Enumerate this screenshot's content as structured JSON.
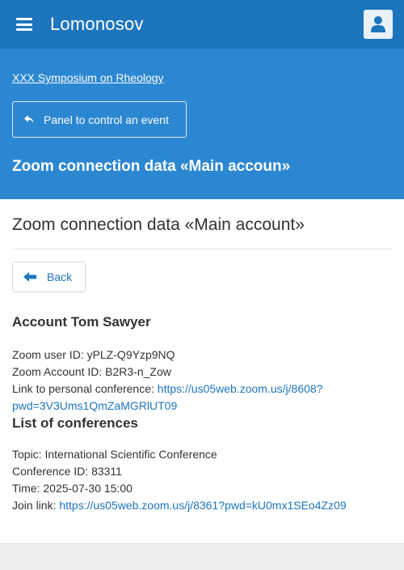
{
  "app": {
    "title": "Lomonosov"
  },
  "icons": {
    "menu": "hamburger-icon",
    "user": "user-icon",
    "reply": "reply-arrow-icon",
    "back": "left-arrow-icon"
  },
  "colors": {
    "topbar": "#1d75bd",
    "hero": "#2b87d2",
    "link": "#1d75bd"
  },
  "hero": {
    "breadcrumb": "XXX Symposium on Rheology",
    "panel_button": "Panel to control an event",
    "title": "Zoom connection data «Main accoun»"
  },
  "main": {
    "title": "Zoom connection data «Main account»",
    "back_label": "Back",
    "account": {
      "heading": "Account Tom Sawyer",
      "user_id_label": "Zoom user ID: ",
      "user_id": "yPLZ-Q9Yzp9NQ",
      "account_id_label": "Zoom Account ID: ",
      "account_id": "B2R3-n_Zow",
      "link_label": "Link to personal conference: ",
      "link_line1": "https://us05web.zoom.us/j/8608?",
      "link_line2": "pwd=3V3Ums1QmZaMGRlUT09"
    },
    "conferences": {
      "heading": "List of conferences",
      "items": [
        {
          "topic_label": "Topic: ",
          "topic": "International Scientific Conference",
          "id_label": "Conference ID: ",
          "id": "83311",
          "time_label": "Time: ",
          "time": "2025-07-30 15:00",
          "join_label": "Join link: ",
          "join_link": "https://us05web.zoom.us/j/8361?pwd=kU0mx1SEo4Zz09"
        }
      ]
    }
  }
}
